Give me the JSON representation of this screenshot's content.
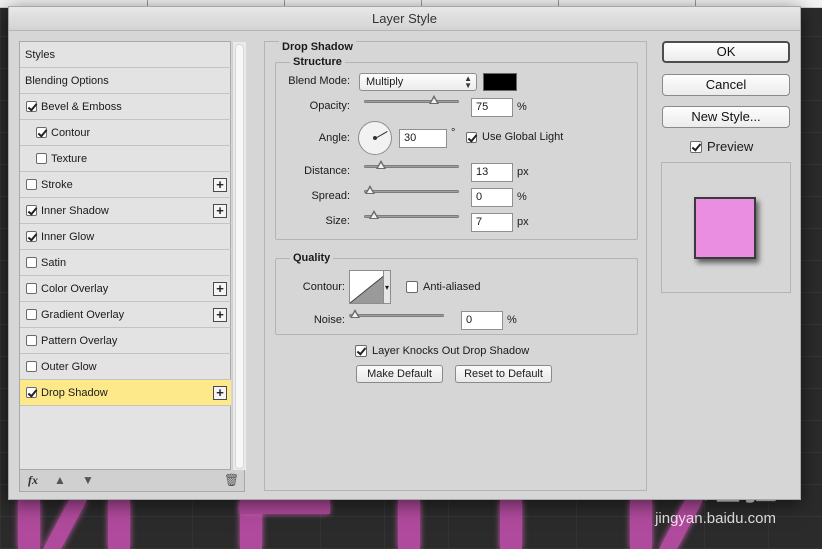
{
  "dialog": {
    "title": "Layer Style"
  },
  "sidebar": {
    "items": [
      {
        "label": "Styles",
        "checked": null,
        "plus": false,
        "selected": false,
        "indent": false
      },
      {
        "label": "Blending Options",
        "checked": null,
        "plus": false,
        "selected": false,
        "indent": false
      },
      {
        "label": "Bevel & Emboss",
        "checked": true,
        "plus": false,
        "selected": false,
        "indent": false
      },
      {
        "label": "Contour",
        "checked": true,
        "plus": false,
        "selected": false,
        "indent": true
      },
      {
        "label": "Texture",
        "checked": false,
        "plus": false,
        "selected": false,
        "indent": true
      },
      {
        "label": "Stroke",
        "checked": false,
        "plus": true,
        "selected": false,
        "indent": false
      },
      {
        "label": "Inner Shadow",
        "checked": true,
        "plus": true,
        "selected": false,
        "indent": false
      },
      {
        "label": "Inner Glow",
        "checked": true,
        "plus": false,
        "selected": false,
        "indent": false
      },
      {
        "label": "Satin",
        "checked": false,
        "plus": false,
        "selected": false,
        "indent": false
      },
      {
        "label": "Color Overlay",
        "checked": false,
        "plus": true,
        "selected": false,
        "indent": false
      },
      {
        "label": "Gradient Overlay",
        "checked": false,
        "plus": true,
        "selected": false,
        "indent": false
      },
      {
        "label": "Pattern Overlay",
        "checked": false,
        "plus": false,
        "selected": false,
        "indent": false
      },
      {
        "label": "Outer Glow",
        "checked": false,
        "plus": false,
        "selected": false,
        "indent": false
      },
      {
        "label": "Drop Shadow",
        "checked": true,
        "plus": true,
        "selected": true,
        "indent": false
      }
    ],
    "footer": {
      "fx_label": "fx",
      "up_icon": "arrow-up-icon",
      "down_icon": "arrow-down-icon",
      "trash_icon": "trash-icon"
    }
  },
  "drop_shadow": {
    "section_title": "Drop Shadow",
    "structure": {
      "title": "Structure",
      "blend_mode": {
        "label": "Blend Mode:",
        "value": "Multiply",
        "color": "#000000"
      },
      "opacity": {
        "label": "Opacity:",
        "value": "75",
        "unit": "%",
        "level": 0.75
      },
      "angle": {
        "label": "Angle:",
        "value": "30",
        "unit": "°"
      },
      "use_global_light": {
        "label": "Use Global Light",
        "checked": true
      },
      "distance": {
        "label": "Distance:",
        "value": "13",
        "unit": "px",
        "level": 0.13
      },
      "spread": {
        "label": "Spread:",
        "value": "0",
        "unit": "%",
        "level": 0.0
      },
      "size": {
        "label": "Size:",
        "value": "7",
        "unit": "px",
        "level": 0.05
      }
    },
    "quality": {
      "title": "Quality",
      "contour": {
        "label": "Contour:"
      },
      "anti_aliased": {
        "label": "Anti-aliased",
        "checked": false
      },
      "noise": {
        "label": "Noise:",
        "value": "0",
        "unit": "%",
        "level": 0.0
      }
    },
    "layer_knocks_out": {
      "label": "Layer Knocks Out Drop Shadow",
      "checked": true
    },
    "make_default_label": "Make Default",
    "reset_default_label": "Reset to Default"
  },
  "actions": {
    "ok_label": "OK",
    "cancel_label": "Cancel",
    "new_style_label": "New Style...",
    "preview": {
      "label": "Preview",
      "checked": true
    },
    "preview_color": "#e98ee0"
  },
  "watermark": {
    "logo": "Baidu经验",
    "url": "jingyan.baidu.com"
  }
}
